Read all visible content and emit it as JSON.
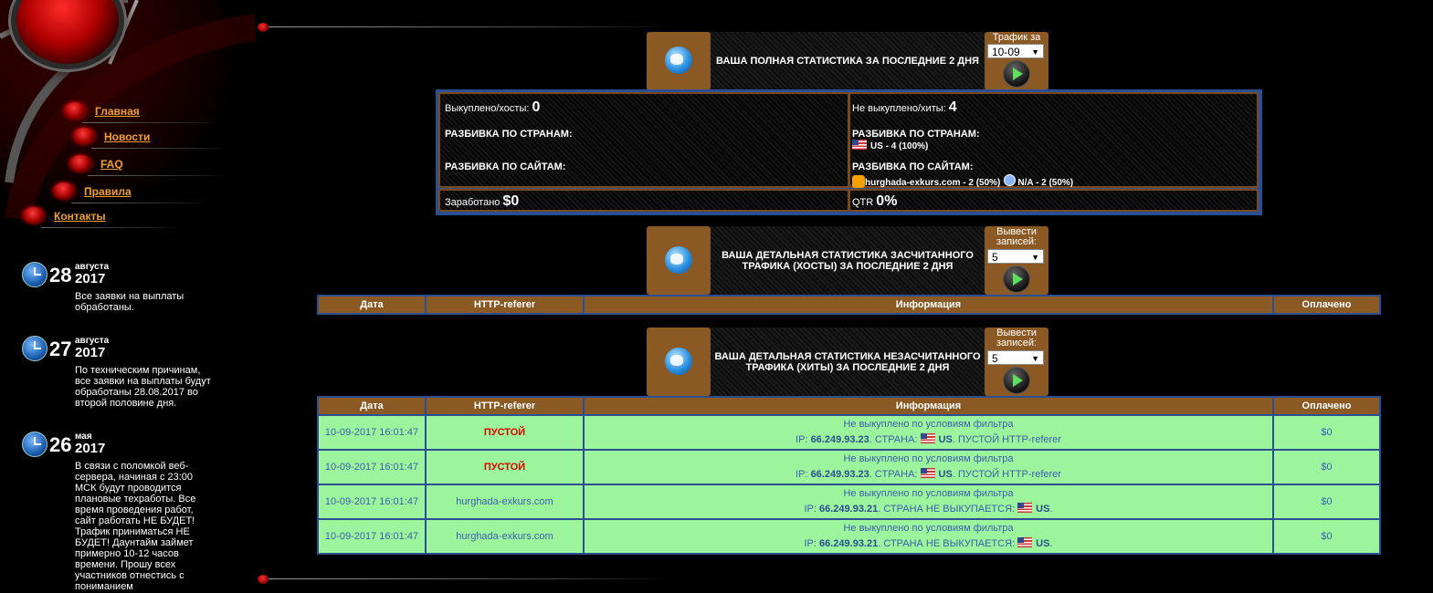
{
  "nav": [
    {
      "label": "Главная"
    },
    {
      "label": "Новости"
    },
    {
      "label": "FAQ"
    },
    {
      "label": "Правила"
    },
    {
      "label": "Контакты"
    }
  ],
  "news": [
    {
      "day": "28",
      "month": "августа",
      "year": "2017",
      "text": "Все заявки на выплаты обработаны."
    },
    {
      "day": "27",
      "month": "августа",
      "year": "2017",
      "text": "По техническим причинам, все заявки на выплаты будут обработаны 28.08.2017 во второй половине дня."
    },
    {
      "day": "26",
      "month": "мая",
      "year": "2017",
      "text": "В связи с поломкой веб-сервера, начиная с 23:00 МСК будут проводится плановые техработы. Все время проведения работ, сайт работать НЕ БУДЕТ! Трафик приниматься НЕ БУДЕТ! Даунтайм займет примерно 10-12 часов времени. Прошу всех участников отнестись с пониманием"
    }
  ],
  "summary_section": {
    "title": "ВАША ПОЛНАЯ СТАТИСТИКА ЗА ПОСЛЕДНИЕ 2 ДНЯ",
    "control_label": "Трафик за",
    "selected": "10-09"
  },
  "summary": {
    "bought_label": "Выкуплено/хосты:",
    "bought_value": "0",
    "not_bought_label": "Не выкуплено/хиты:",
    "not_bought_value": "4",
    "countries_label": "РАЗБИВКА ПО СТРАНАМ:",
    "sites_label": "РАЗБИВКА ПО САЙТАМ:",
    "country_us": "US - 4 (100%)",
    "site_1": "hurghada-exkurs.com - 2 (50%)",
    "site_2": "N/A - 2 (50%)",
    "earned_label": "Заработано",
    "earned_value": "$0",
    "qtr_label": "QTR",
    "qtr_value": "0%"
  },
  "hosts_section": {
    "title": "ВАША ДЕТАЛЬНАЯ СТАТИСТИКА ЗАСЧИТАННОГО ТРАФИКА (ХОСТЫ) ЗА ПОСЛЕДНИЕ 2 ДНЯ",
    "control_label": "Вывести записей:",
    "selected": "5"
  },
  "hits_section": {
    "title": "ВАША ДЕТАЛЬНАЯ СТАТИСТИКА НЕЗАСЧИТАННОГО ТРАФИКА (ХИТЫ) ЗА ПОСЛЕДНИЕ 2 ДНЯ",
    "control_label": "Вывести записей:",
    "selected": "5"
  },
  "table_headers": {
    "date": "Дата",
    "referer": "HTTP-referer",
    "info": "Информация",
    "paid": "Оплачено"
  },
  "hits_rows": [
    {
      "date": "10-09-2017 16:01:47",
      "referer": "ПУСТОЙ",
      "info1": "Не выкуплено по условиям фильтра",
      "ip_label": "IP:",
      "ip": "66.249.93.23",
      "rest": ". СТРАНА:",
      "cc": "US",
      "tail": ". ПУСТОЙ HTTP-referer",
      "paid": "$0"
    },
    {
      "date": "10-09-2017 16:01:47",
      "referer": "ПУСТОЙ",
      "info1": "Не выкуплено по условиям фильтра",
      "ip_label": "IP:",
      "ip": "66.249.93.23",
      "rest": ". СТРАНА:",
      "cc": "US",
      "tail": ". ПУСТОЙ HTTP-referer",
      "paid": "$0"
    },
    {
      "date": "10-09-2017 16:01:47",
      "referer": "hurghada-exkurs.com",
      "info1": "Не выкуплено по условиям фильтра",
      "ip_label": "IP:",
      "ip": "66.249.93.21",
      "rest": ". СТРАНА НЕ ВЫКУПАЕТСЯ:",
      "cc": "US",
      "tail": ".",
      "paid": "$0"
    },
    {
      "date": "10-09-2017 16:01:47",
      "referer": "hurghada-exkurs.com",
      "info1": "Не выкуплено по условиям фильтра",
      "ip_label": "IP:",
      "ip": "66.249.93.21",
      "rest": ". СТРАНА НЕ ВЫКУПАЕТСЯ:",
      "cc": "US",
      "tail": ".",
      "paid": "$0"
    }
  ],
  "colors": {
    "brown": "#8b5a24",
    "blue_border": "#2a4f93",
    "row_green": "#9cf59c",
    "link_orange": "#f0a030",
    "empty_red": "#e00000"
  }
}
